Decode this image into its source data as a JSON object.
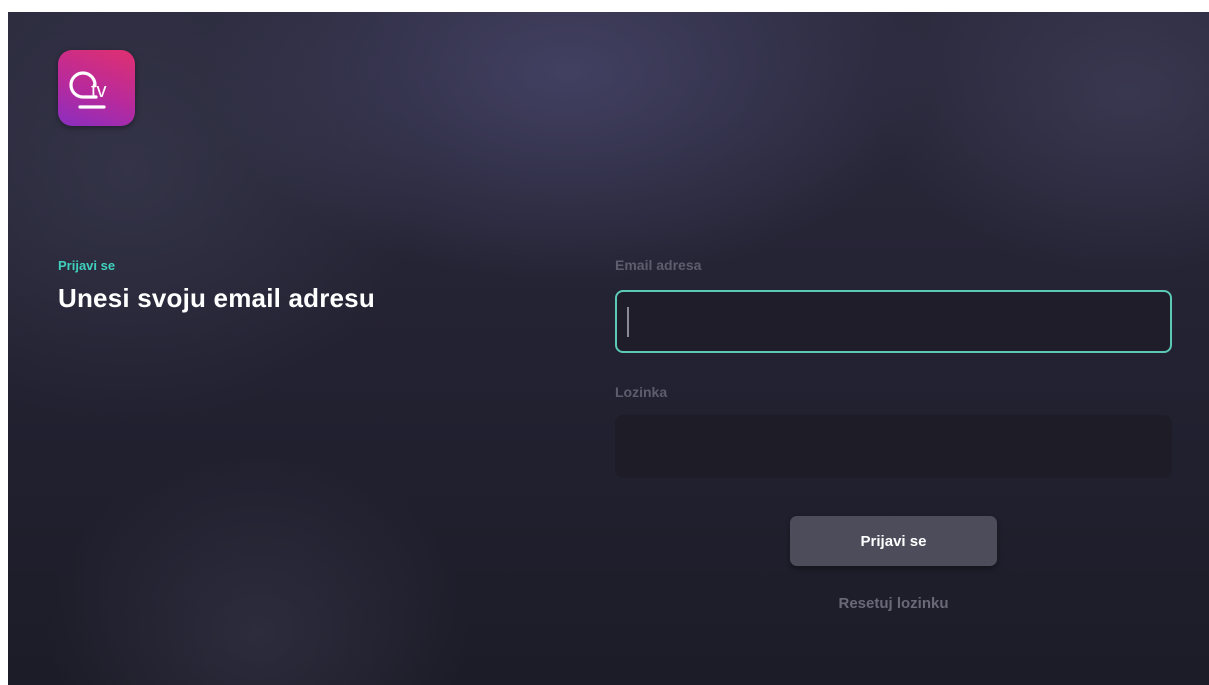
{
  "app": {
    "logo_text": "tv",
    "logo_icon": "tv-logo-icon",
    "colors": {
      "accent": "#3fd1bd",
      "logo_gradient_start": "#e0306f",
      "logo_gradient_end": "#8a2ec0"
    }
  },
  "header": {
    "kicker": "Prijavi se",
    "title": "Unesi svoju email adresu"
  },
  "form": {
    "email_label": "Email adresa",
    "email_value": "",
    "password_label": "Lozinka",
    "password_value": "",
    "submit_label": "Prijavi se",
    "reset_label": "Resetuj lozinku"
  }
}
